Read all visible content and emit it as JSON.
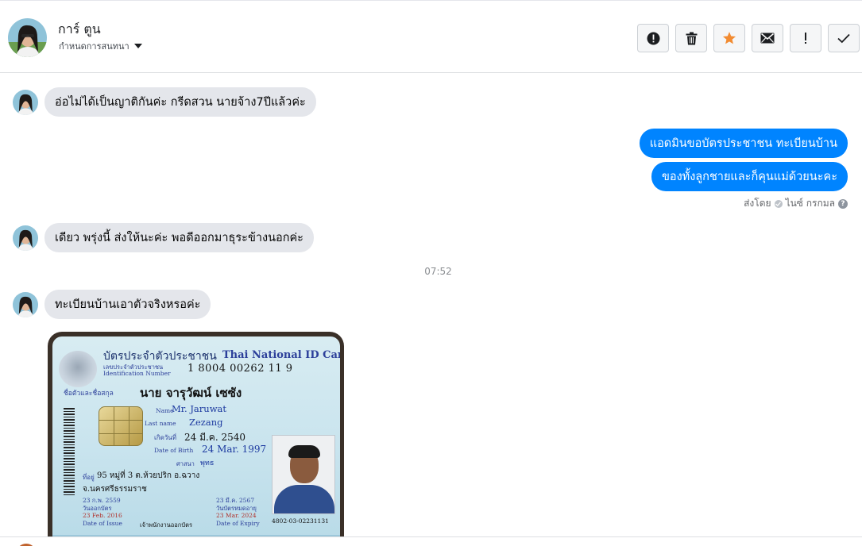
{
  "header": {
    "contact_name": "การ์ ตูน",
    "assign_label": "กำหนดการสนทนา",
    "toolbar": {
      "icons": [
        "alert-circle-icon",
        "trash-icon",
        "star-icon",
        "envelope-icon",
        "exclamation-icon",
        "checkmark-icon"
      ]
    }
  },
  "thread": {
    "messages": [
      {
        "direction": "incoming",
        "text": "อ่อไม่ได้เป็นญาติกันค่ะ กรีดสวน นายจ้าง7ปีแล้วค่ะ"
      },
      {
        "direction": "outgoing",
        "text": "แอดมินขอบัตรประชาชน ทะเบียนบ้าน"
      },
      {
        "direction": "outgoing",
        "text": "ของทั้งลูกชายและก็คุนแม่ด้วยนะคะ"
      },
      {
        "direction": "incoming",
        "text": "เดียว พรุ่งนี้ ส่งให้นะค่ะ พอดีออกมาธุระข้างนอกค่ะ"
      },
      {
        "direction": "incoming",
        "text": "ทะเบียนบ้านเอาตัวจริงหรอค่ะ"
      }
    ],
    "sent_by_label": "ส่งโดย",
    "sent_by_name": "ไนซ์ กรกมล",
    "timestamp": "07:52"
  },
  "id_card": {
    "title_th": "บัตรประจำตัวประชาชน",
    "title_en": "Thai National ID Card",
    "id_label_th": "เลขประจำตัวประชาชน",
    "id_label_en": "Identification Number",
    "id_number": "1 8004 00262 11 9",
    "name_label_th": "ชื่อตัวและชื่อสกุล",
    "name_th": "นาย จารุวัฒน์ เซซัง",
    "name_label_en": "Name",
    "name_en": "Mr. Jaruwat",
    "last_name_label": "Last name",
    "last_name": "Zezang",
    "dob_label_th": "เกิดวันที่",
    "dob_th": "24 มี.ค. 2540",
    "dob_label_en": "Date of Birth",
    "dob_en": "24 Mar. 1997",
    "religion_label": "ศาสนา",
    "religion": "พุทธ",
    "address_label": "ที่อยู่",
    "address_line1": "95 หมู่ที่ 3 ต.ห้วยปริก อ.ฉวาง",
    "address_line2": "จ.นครศรีธรรมราช",
    "issue_date_th": "23 ก.พ. 2559",
    "issue_label_th": "วันออกบัตร",
    "issue_date_en": "23 Feb. 2016",
    "issue_label_en": "Date of Issue",
    "expiry_date_th": "23 มี.ค. 2567",
    "expiry_label_th": "วันบัตรหมดอายุ",
    "expiry_date_en": "23 Mar. 2024",
    "expiry_label_en": "Date of Expiry",
    "officer_title": "เจ้าพนักงานออกบัตร",
    "card_code": "4802-03-02231131"
  }
}
